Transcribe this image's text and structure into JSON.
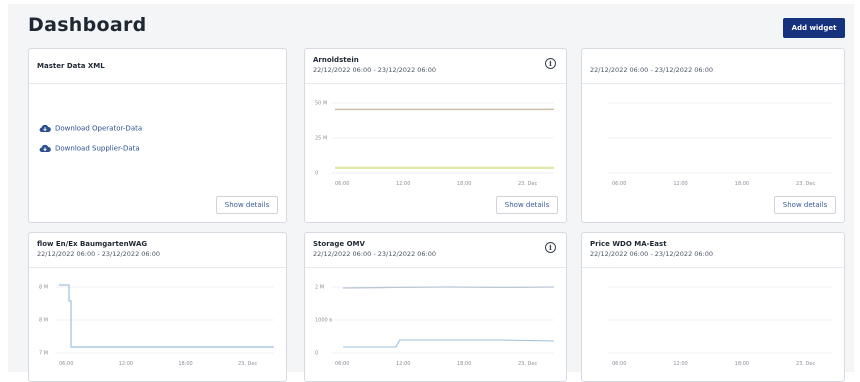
{
  "page": {
    "title": "Dashboard",
    "add_widget_label": "Add widget"
  },
  "colors": {
    "accent": "#16317d",
    "link": "#2c4f8f",
    "gridline": "#eceef1",
    "series_tan": "#cdbfa8",
    "series_green": "#e8ecb8",
    "series_blue": "#9cc0de"
  },
  "cards": [
    {
      "title": "Master Data XML",
      "links": [
        "Download Operator-Data",
        "Download Supplier-Data"
      ],
      "details_label": "Show details"
    },
    {
      "title": "Arnoldstein",
      "subtitle": "22/12/2022 06:00 - 23/12/2022 06:00",
      "details_label": "Show details",
      "chart_data": {
        "type": "line",
        "x": [
          "06:00",
          "12:00",
          "18:00",
          "23. Dec"
        ],
        "y_ticks": [
          "50 M",
          "25 M",
          "0"
        ],
        "ylim": [
          0,
          55
        ],
        "series": [
          {
            "values": [
              50,
              50,
              50,
              50
            ],
            "color": "#cdbfa8"
          },
          {
            "values": [
              4,
              4,
              4,
              4
            ],
            "color": "#e3e8a6"
          }
        ]
      }
    },
    {
      "title": "",
      "subtitle": "22/12/2022 06:00 - 23/12/2022 06:00",
      "details_label": "Show details",
      "chart_data": {
        "type": "line",
        "x": [
          "06:00",
          "12:00",
          "18:00",
          "23. Dec"
        ],
        "y_ticks": [],
        "series": []
      }
    },
    {
      "title": "flow En/Ex BaumgartenWAG",
      "subtitle": "22/12/2022 06:00 - 23/12/2022 06:00",
      "chart_data": {
        "type": "line",
        "x": [
          "06:00",
          "12:00",
          "18:00",
          "23. Dec"
        ],
        "y_ticks": [
          "8 M",
          "8 M",
          "7 M"
        ],
        "series": [
          {
            "values": [
              8.6,
              8.6,
              7.05,
              7.05
            ],
            "color": "#9cc0de"
          }
        ]
      }
    },
    {
      "title": "Storage OMV",
      "subtitle": "22/12/2022 06:00 - 23/12/2022 06:00",
      "chart_data": {
        "type": "line",
        "x": [
          "06:00",
          "12:00",
          "18:00",
          "23. Dec"
        ],
        "y_ticks": [
          "2 M",
          "1000 k",
          "0"
        ],
        "series": [
          {
            "values": [
              2.05,
              2.08,
              2.1,
              2.08,
              2.1
            ],
            "color": "#b9c6d6"
          },
          {
            "values": [
              0.15,
              0.15,
              0.35,
              0.35,
              0.3
            ],
            "color": "#9cc0de"
          }
        ]
      }
    },
    {
      "title": "Price WDO MA-East",
      "subtitle": "22/12/2022 06:00 - 23/12/2022 06:00",
      "chart_data": {
        "type": "line",
        "x": [
          "06:00",
          "12:00",
          "18:00",
          "23. Dec"
        ],
        "y_ticks": [],
        "series": []
      }
    }
  ]
}
